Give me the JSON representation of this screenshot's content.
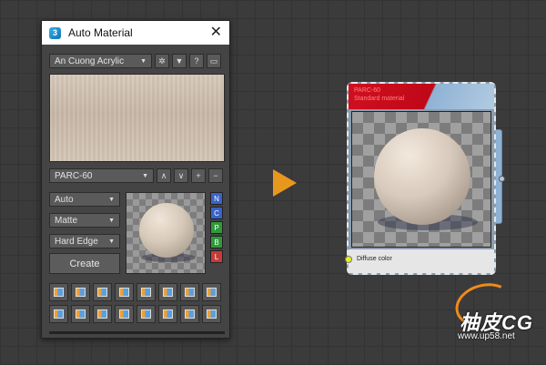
{
  "panel": {
    "title": "Auto Material",
    "close_glyph": "✕",
    "library": "An Cuong Acrylic",
    "material_code": "PARC-60",
    "mode": "Auto",
    "finish": "Matte",
    "edge": "Hard Edge",
    "create_label": "Create",
    "help_glyph": "?",
    "channels": [
      {
        "label": "N",
        "color": "#3a63c8"
      },
      {
        "label": "C",
        "color": "#3a63c8"
      },
      {
        "label": "P",
        "color": "#2f9a3a"
      },
      {
        "label": "B",
        "color": "#2f9a3a"
      },
      {
        "label": "L",
        "color": "#c83a3a"
      }
    ],
    "accent": "#e8971e"
  },
  "node": {
    "title_line1": "PARC-60",
    "title_line2": "Standard material",
    "port_label": "Diffuse color"
  },
  "watermark": {
    "text": "柚皮CG",
    "url": "www.up58.net"
  }
}
